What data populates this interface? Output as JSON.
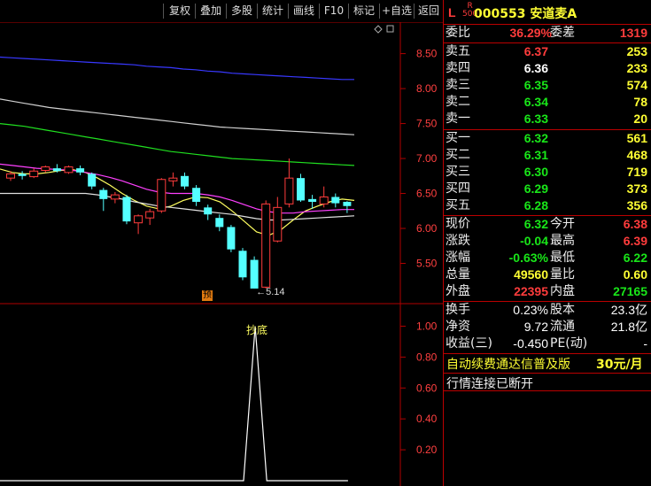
{
  "toolbar": {
    "buttons": [
      "复权",
      "叠加",
      "多股",
      "统计",
      "画线",
      "F10",
      "标记",
      "+自选",
      "返回"
    ]
  },
  "stock": {
    "market_badge": "L",
    "r_badge": "R",
    "r_sub": "500",
    "code_name": "000553 安道麦A"
  },
  "order_book": {
    "weibi_label": "委比",
    "weibi_value": "36.29%",
    "weicha_label": "委差",
    "weicha_value": "1319",
    "asks": [
      {
        "label": "卖五",
        "price": "6.37",
        "vol": "253"
      },
      {
        "label": "卖四",
        "price": "6.36",
        "vol": "233"
      },
      {
        "label": "卖三",
        "price": "6.35",
        "vol": "574"
      },
      {
        "label": "卖二",
        "price": "6.34",
        "vol": "78"
      },
      {
        "label": "卖一",
        "price": "6.33",
        "vol": "20"
      }
    ],
    "bids": [
      {
        "label": "买一",
        "price": "6.32",
        "vol": "561"
      },
      {
        "label": "买二",
        "price": "6.31",
        "vol": "468"
      },
      {
        "label": "买三",
        "price": "6.30",
        "vol": "719"
      },
      {
        "label": "买四",
        "price": "6.29",
        "vol": "373"
      },
      {
        "label": "买五",
        "price": "6.28",
        "vol": "356"
      }
    ]
  },
  "quote": {
    "rows": [
      {
        "l1": "现价",
        "v1": "6.32",
        "l2": "今开",
        "v2": "6.38"
      },
      {
        "l1": "涨跌",
        "v1": "-0.04",
        "l2": "最高",
        "v2": "6.39"
      },
      {
        "l1": "涨幅",
        "v1": "-0.63%",
        "l2": "最低",
        "v2": "6.22"
      },
      {
        "l1": "总量",
        "v1": "49560",
        "l2": "量比",
        "v2": "0.60"
      },
      {
        "l1": "外盘",
        "v1": "22395",
        "l2": "内盘",
        "v2": "27165"
      }
    ]
  },
  "finance": {
    "rows": [
      {
        "l1": "换手",
        "v1": "0.23%",
        "l2": "股本",
        "v2": "23.3亿"
      },
      {
        "l1": "净资",
        "v1": "9.72",
        "l2": "流通",
        "v2": "21.8亿"
      },
      {
        "l1": "收益(三)",
        "v1": "-0.450",
        "l2": "PE(动)",
        "v2": "-"
      }
    ]
  },
  "promo": {
    "text": "自动续费通达信普及版",
    "price": "30元/月"
  },
  "status": {
    "text": "行情连接已断开"
  },
  "main_chart": {
    "y_ticks": [
      "8.50",
      "8.00",
      "7.50",
      "7.00",
      "6.50",
      "6.00",
      "5.50"
    ],
    "low_marker": "5.14",
    "pre_badge": "预"
  },
  "indicator": {
    "y_ticks": [
      "1.00",
      "0.80",
      "0.60",
      "0.40",
      "0.20"
    ],
    "signal_label": "抄底"
  },
  "chart_data": {
    "type": "candlestick",
    "y_range": [
      5.0,
      8.9
    ],
    "candles": [
      {
        "o": 6.72,
        "c": 6.78,
        "h": 6.82,
        "l": 6.68
      },
      {
        "o": 6.78,
        "c": 6.75,
        "h": 6.82,
        "l": 6.7
      },
      {
        "o": 6.74,
        "c": 6.82,
        "h": 6.86,
        "l": 6.72
      },
      {
        "o": 6.83,
        "c": 6.88,
        "h": 6.9,
        "l": 6.8
      },
      {
        "o": 6.86,
        "c": 6.82,
        "h": 6.92,
        "l": 6.8
      },
      {
        "o": 6.8,
        "c": 6.88,
        "h": 6.9,
        "l": 6.78
      },
      {
        "o": 6.86,
        "c": 6.8,
        "h": 6.9,
        "l": 6.76
      },
      {
        "o": 6.78,
        "c": 6.6,
        "h": 6.8,
        "l": 6.56
      },
      {
        "o": 6.55,
        "c": 6.42,
        "h": 6.58,
        "l": 6.25
      },
      {
        "o": 6.42,
        "c": 6.48,
        "h": 6.52,
        "l": 6.36
      },
      {
        "o": 6.45,
        "c": 6.1,
        "h": 6.48,
        "l": 6.06
      },
      {
        "o": 6.08,
        "c": 6.18,
        "h": 6.2,
        "l": 5.92
      },
      {
        "o": 6.15,
        "c": 6.24,
        "h": 6.28,
        "l": 6.05
      },
      {
        "o": 6.25,
        "c": 6.7,
        "h": 6.72,
        "l": 6.22
      },
      {
        "o": 6.68,
        "c": 6.72,
        "h": 6.8,
        "l": 6.6
      },
      {
        "o": 6.75,
        "c": 6.6,
        "h": 6.8,
        "l": 6.56
      },
      {
        "o": 6.58,
        "c": 6.38,
        "h": 6.62,
        "l": 6.32
      },
      {
        "o": 6.3,
        "c": 6.2,
        "h": 6.34,
        "l": 6.12
      },
      {
        "o": 6.15,
        "c": 6.02,
        "h": 6.2,
        "l": 5.96
      },
      {
        "o": 6.02,
        "c": 5.7,
        "h": 6.05,
        "l": 5.66
      },
      {
        "o": 5.68,
        "c": 5.3,
        "h": 5.72,
        "l": 5.26
      },
      {
        "o": 5.55,
        "c": 5.14,
        "h": 5.6,
        "l": 5.14
      },
      {
        "o": 5.16,
        "c": 6.35,
        "h": 6.4,
        "l": 5.14
      },
      {
        "o": 5.82,
        "c": 6.3,
        "h": 6.45,
        "l": 5.8
      },
      {
        "o": 6.35,
        "c": 6.72,
        "h": 7.0,
        "l": 6.3
      },
      {
        "o": 6.72,
        "c": 6.4,
        "h": 6.78,
        "l": 6.38
      },
      {
        "o": 6.42,
        "c": 6.38,
        "h": 6.48,
        "l": 6.28
      },
      {
        "o": 6.35,
        "c": 6.45,
        "h": 6.6,
        "l": 6.3
      },
      {
        "o": 6.45,
        "c": 6.36,
        "h": 6.5,
        "l": 6.3
      },
      {
        "o": 6.38,
        "c": 6.32,
        "h": 6.39,
        "l": 6.22
      }
    ],
    "ma_series": [
      {
        "color": "#ffff60",
        "values": [
          6.85,
          6.8,
          6.78,
          6.78,
          6.8,
          6.83,
          6.84,
          6.8,
          6.72,
          6.62,
          6.5,
          6.4,
          6.32,
          6.28,
          6.32,
          6.4,
          6.45,
          6.44,
          6.38,
          6.25,
          6.1,
          5.95,
          5.9,
          5.98,
          6.12,
          6.25,
          6.32,
          6.38,
          6.42,
          6.4
        ]
      },
      {
        "color": "#ff40ff",
        "values": [
          6.92,
          6.9,
          6.88,
          6.86,
          6.85,
          6.84,
          6.83,
          6.8,
          6.77,
          6.73,
          6.68,
          6.62,
          6.56,
          6.52,
          6.5,
          6.5,
          6.5,
          6.48,
          6.45,
          6.4,
          6.34,
          6.28,
          6.24,
          6.22,
          6.22,
          6.24,
          6.25,
          6.26,
          6.27,
          6.27
        ]
      },
      {
        "color": "#e0e0e0",
        "values": [
          6.5,
          6.5,
          6.5,
          6.5,
          6.5,
          6.5,
          6.5,
          6.5,
          6.48,
          6.45,
          6.42,
          6.38,
          6.35,
          6.32,
          6.3,
          6.28,
          6.26,
          6.24,
          6.22,
          6.2,
          6.17,
          6.14,
          6.12,
          6.12,
          6.13,
          6.14,
          6.15,
          6.16,
          6.17,
          6.18
        ]
      },
      {
        "color": "#20e020",
        "values": [
          7.5,
          7.48,
          7.46,
          7.43,
          7.4,
          7.37,
          7.34,
          7.31,
          7.28,
          7.25,
          7.22,
          7.19,
          7.16,
          7.13,
          7.1,
          7.08,
          7.06,
          7.04,
          7.02,
          7.0,
          6.99,
          6.98,
          6.97,
          6.96,
          6.95,
          6.94,
          6.93,
          6.92,
          6.91,
          6.9
        ]
      },
      {
        "color": "#d0d0d0",
        "values": [
          7.85,
          7.82,
          7.79,
          7.76,
          7.73,
          7.71,
          7.69,
          7.67,
          7.65,
          7.63,
          7.61,
          7.59,
          7.57,
          7.55,
          7.53,
          7.51,
          7.49,
          7.47,
          7.45,
          7.44,
          7.43,
          7.42,
          7.41,
          7.4,
          7.39,
          7.38,
          7.37,
          7.36,
          7.35,
          7.34
        ]
      },
      {
        "color": "#3838ff",
        "values": [
          8.45,
          8.44,
          8.43,
          8.42,
          8.41,
          8.4,
          8.39,
          8.38,
          8.37,
          8.36,
          8.35,
          8.34,
          8.32,
          8.31,
          8.3,
          8.28,
          8.27,
          8.25,
          8.24,
          8.22,
          8.21,
          8.2,
          8.19,
          8.18,
          8.17,
          8.16,
          8.15,
          8.14,
          8.13,
          8.13
        ]
      }
    ],
    "indicator_values": [
      0,
      0,
      0,
      0,
      0,
      0,
      0,
      0,
      0,
      0,
      0,
      0,
      0,
      0,
      0,
      0,
      0,
      0,
      0,
      0,
      0,
      1,
      0,
      0,
      0,
      0,
      0,
      0,
      0,
      0
    ],
    "indicator_range": [
      0,
      1.1
    ]
  }
}
